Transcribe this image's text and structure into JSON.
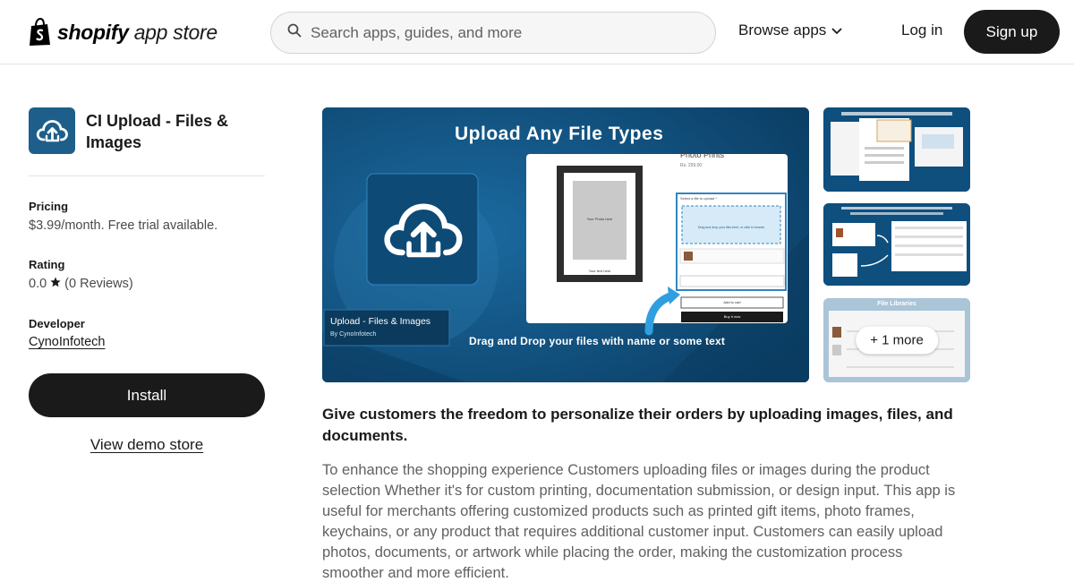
{
  "header": {
    "brand": "shopify",
    "store_suffix": "app store",
    "search_placeholder": "Search apps, guides, and more",
    "browse_label": "Browse apps",
    "login_label": "Log in",
    "signup_label": "Sign up"
  },
  "app": {
    "title": "CI Upload - Files & Images",
    "pricing_label": "Pricing",
    "pricing_value": "$3.99/month. Free trial available.",
    "rating_label": "Rating",
    "rating_score": "0.0",
    "rating_reviews": "(0 Reviews)",
    "developer_label": "Developer",
    "developer_name": "CynoInfotech",
    "install_label": "Install",
    "demo_label": "View demo store"
  },
  "media": {
    "hero_heading": "Upload Any File Types",
    "hero_app_name": "Upload - Files & Images",
    "hero_byline": "By CynoInfotech",
    "hero_caption": "Drag and Drop your files with name or some text",
    "mock_product": "Photo Prints",
    "mock_price": "Rs. 299.00",
    "mock_photo_text": "Your Photo here",
    "mock_text_here": "Your text here",
    "mock_select_label": "Select a file to upload *",
    "mock_drop_text": "Drag and drop your files here, or click to browse",
    "mock_add_to_cart": "Add to cart",
    "mock_buy_now": "Buy it now",
    "thumb3_title": "File Libraries",
    "more_label": "+ 1 more"
  },
  "description": {
    "headline": "Give customers the freedom to personalize their orders by uploading images, files, and documents.",
    "body": "To enhance the shopping experience Customers uploading files or images during the product selection Whether it's for custom printing, documentation submission, or design input. This app is useful for merchants offering customized products such as printed gift items, photo frames, keychains, or any product that requires additional customer input. Customers can easily upload photos, documents, or artwork while placing the order, making the customization process smoother and more efficient."
  },
  "colors": {
    "brand_dark": "#1a1a1a",
    "app_icon_bg": "#1d5f8a",
    "hero_bg": "#0e4f7e"
  }
}
